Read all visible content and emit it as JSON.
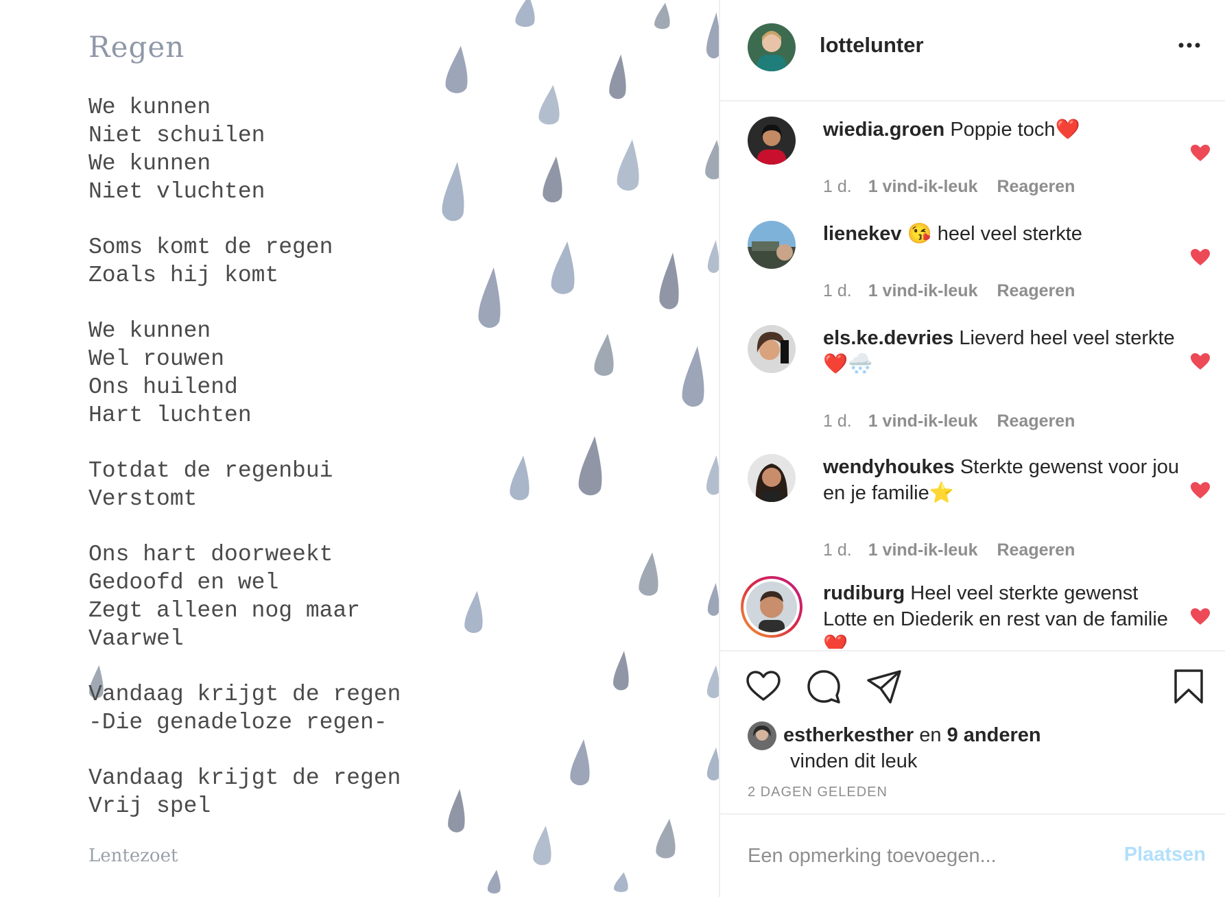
{
  "poem": {
    "title": "Regen",
    "stanzas": [
      [
        "We kunnen",
        "Niet schuilen",
        "We kunnen",
        "Niet vluchten"
      ],
      [
        "Soms komt de regen",
        "Zoals hij komt"
      ],
      [
        "We kunnen",
        "Wel rouwen",
        "Ons huilend",
        "Hart luchten"
      ],
      [
        "Totdat de regenbui",
        "Verstomt"
      ],
      [
        "Ons hart doorweekt",
        "Gedoofd en wel",
        "Zegt alleen nog maar",
        "Vaarwel"
      ],
      [
        "Vandaag krijgt de regen",
        "-Die genadeloze regen-"
      ],
      [
        "Vandaag krijgt de regen",
        "Vrij spel"
      ]
    ],
    "signature": "Lentezoet"
  },
  "header": {
    "username": "lottelunter",
    "more_icon": "more-horizontal-icon"
  },
  "comments": [
    {
      "user": "wiedia.groen",
      "text": "Poppie toch❤️",
      "time": "1 d.",
      "likes": "1 vind-ik-leuk",
      "reply": "Reageren"
    },
    {
      "user": "lienekev",
      "text": "😘 heel veel sterkte",
      "time": "1 d.",
      "likes": "1 vind-ik-leuk",
      "reply": "Reageren"
    },
    {
      "user": "els.ke.devries",
      "text": "Lieverd heel veel sterkte ❤️🌨️",
      "time": "1 d.",
      "likes": "1 vind-ik-leuk",
      "reply": "Reageren"
    },
    {
      "user": "wendyhoukes",
      "text": "Sterkte gewenst voor jou en je familie⭐",
      "time": "1 d.",
      "likes": "1 vind-ik-leuk",
      "reply": "Reageren"
    },
    {
      "user": "rudiburg",
      "text": "Heel veel sterkte gewenst Lotte en Diederik en rest van de familie ❤️",
      "time": "",
      "likes": "",
      "reply": ""
    }
  ],
  "actions": {
    "icons": [
      "heart-icon",
      "comment-icon",
      "share-icon",
      "bookmark-icon"
    ]
  },
  "likes": {
    "user": "estherkesther",
    "joiner": "en",
    "others": "9 anderen",
    "suffix": "vinden dit leuk"
  },
  "post_time": "2 DAGEN GELEDEN",
  "add_comment": {
    "placeholder": "Een opmerking toevoegen...",
    "button": "Plaatsen"
  },
  "colors": {
    "like_red": "#ed4956",
    "disabled_blue": "#b2dffc",
    "secondary_text": "#8e8e8e",
    "drop_grey_blue": "#8d95ad"
  }
}
